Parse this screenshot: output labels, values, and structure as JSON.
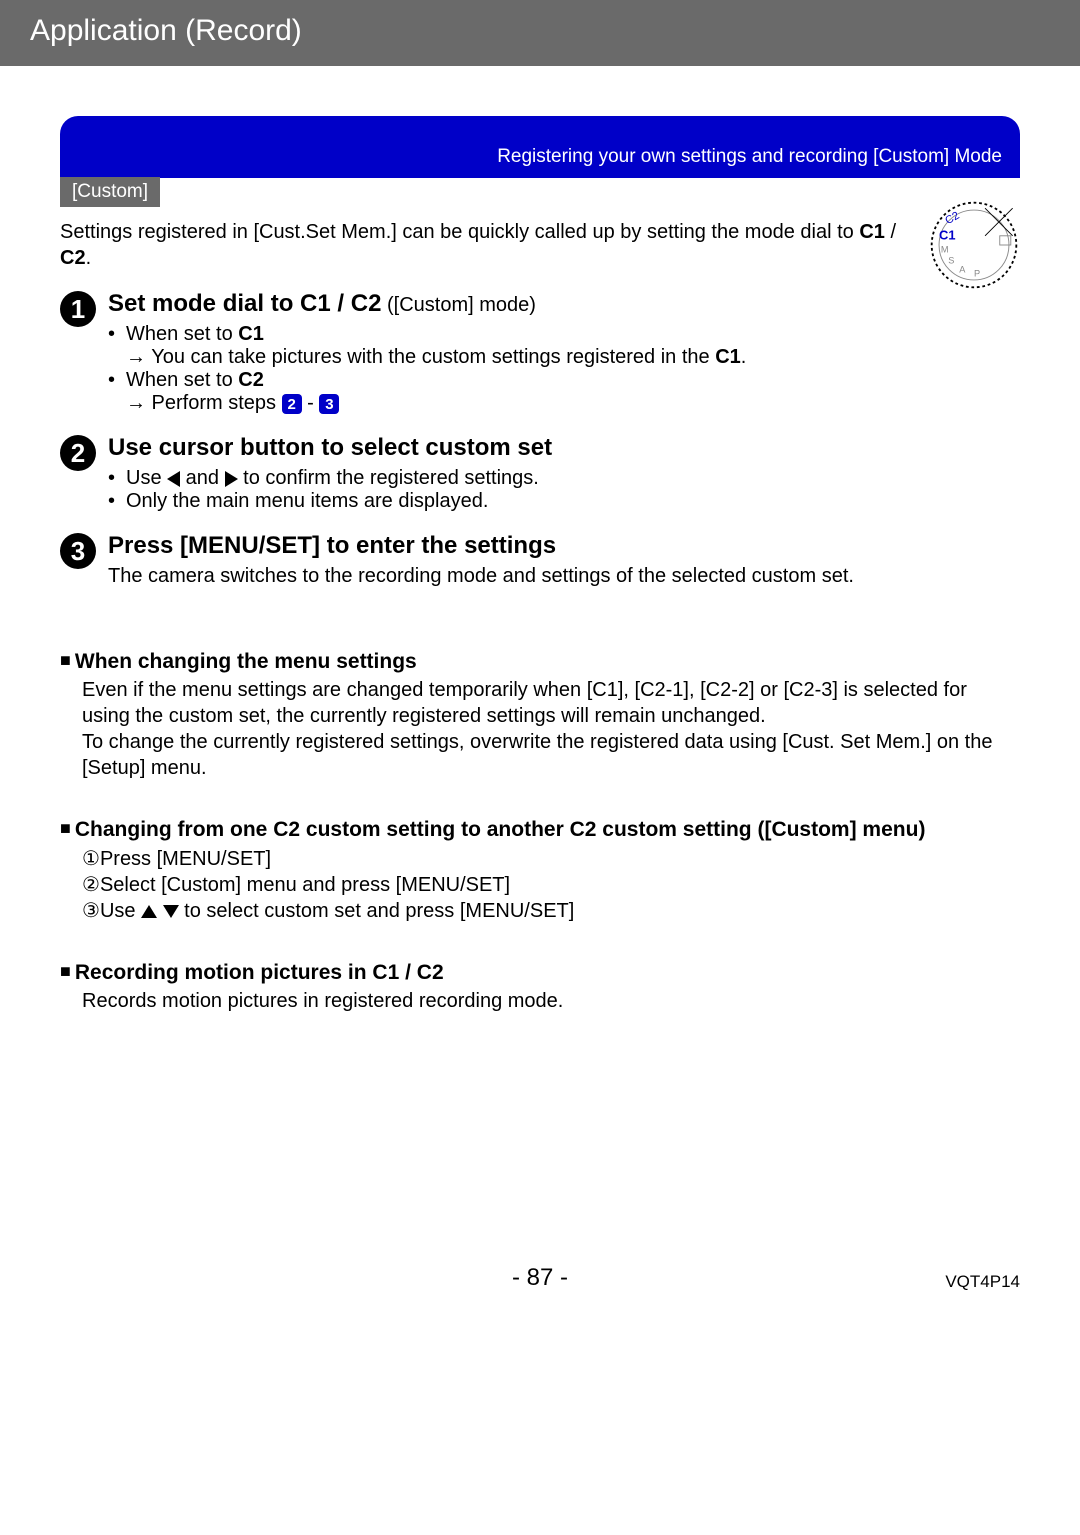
{
  "header": "Application (Record)",
  "banner": "Registering your own settings and recording   [Custom] Mode",
  "subbanner": "[Custom]",
  "intro_a": "Settings registered in [Cust.Set Mem.] can be quickly called up by setting the mode dial to ",
  "c1": "C1",
  "c2": "C2",
  "slash": " / ",
  "period": ".",
  "steps": [
    {
      "num": "1",
      "title_a": "Set mode dial to ",
      "title_b": " ([Custom] mode)",
      "b1": "When set to ",
      "b1sub": "→ You can take pictures with the custom settings registered in the ",
      "b2": "When set to ",
      "b2sub": "→ Perform steps "
    },
    {
      "num": "2",
      "title": "Use cursor button to select custom set",
      "b1a": "Use ",
      "b1b": " and ",
      "b1c": " to confirm the registered settings.",
      "b2": "Only the main menu items are displayed."
    },
    {
      "num": "3",
      "title": "Press [MENU/SET] to enter the settings",
      "body": "The camera switches to the recording mode and settings of the selected custom set."
    }
  ],
  "sec1_h": "When changing the menu settings",
  "sec1_p1": "Even if the menu settings are changed temporarily when [C1], [C2-1], [C2-2] or [C2-3] is selected for using the custom set, the currently registered settings will remain unchanged.",
  "sec1_p2": "To change the currently registered settings, overwrite the registered data using [Cust. Set Mem.] on the [Setup] menu.",
  "sec2_h_a": "Changing from one ",
  "sec2_h_b": " custom setting to another ",
  "sec2_h_c": " custom setting ([Custom] menu)",
  "sec2_l1": "Press [MENU/SET]",
  "sec2_l2": "Select [Custom] menu and press [MENU/SET]",
  "sec2_l3a": "Use ",
  "sec2_l3b": " to select custom set and press [MENU/SET]",
  "sec3_h_a": "Recording motion pictures in ",
  "sec3_body": "Records motion pictures in registered recording mode.",
  "circled": [
    "①",
    "②",
    "③"
  ],
  "step_chips": [
    "2",
    "3"
  ],
  "page": "- 87 -",
  "docid": "VQT4P14"
}
